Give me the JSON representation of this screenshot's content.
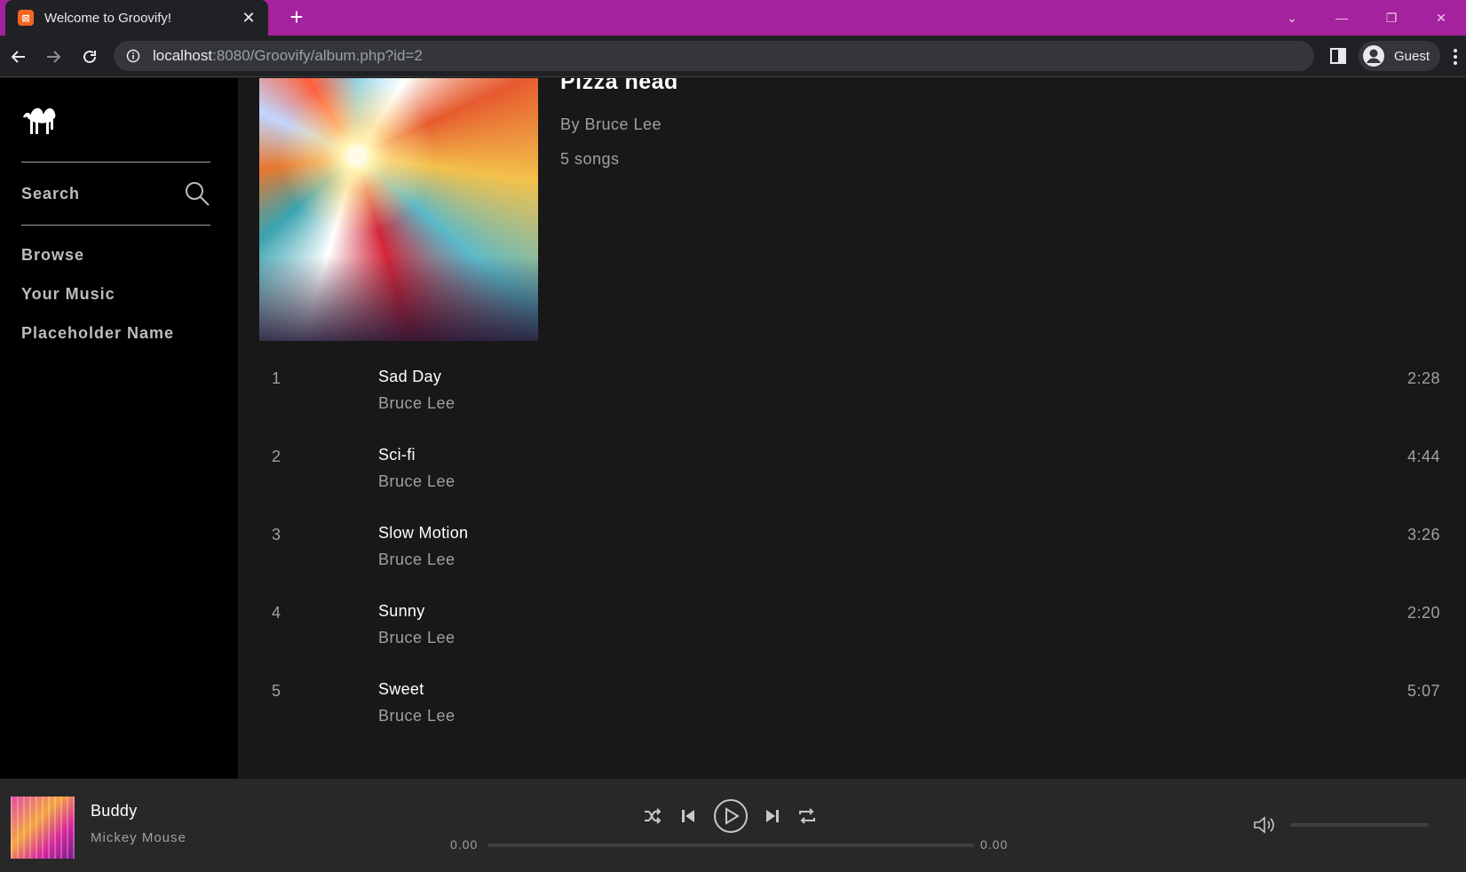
{
  "browser": {
    "tab_title": "Welcome to Groovify!",
    "tab_favicon": "xampp-icon",
    "url_host": "localhost",
    "url_rest": ":8080/Groovify/album.php?id=2",
    "profile_label": "Guest"
  },
  "sidebar": {
    "search_label": "Search",
    "items": [
      {
        "label": "Browse"
      },
      {
        "label": "Your Music"
      },
      {
        "label": "Placeholder Name"
      }
    ]
  },
  "album": {
    "title": "Pizza head",
    "artist": "By Bruce Lee",
    "song_count": "5 songs"
  },
  "tracks": [
    {
      "num": "1",
      "name": "Sad Day",
      "artist": "Bruce Lee",
      "duration": "2:28"
    },
    {
      "num": "2",
      "name": "Sci-fi",
      "artist": "Bruce Lee",
      "duration": "4:44"
    },
    {
      "num": "3",
      "name": "Slow Motion",
      "artist": "Bruce Lee",
      "duration": "3:26"
    },
    {
      "num": "4",
      "name": "Sunny",
      "artist": "Bruce Lee",
      "duration": "2:20"
    },
    {
      "num": "5",
      "name": "Sweet",
      "artist": "Bruce Lee",
      "duration": "5:07"
    }
  ],
  "player": {
    "title": "Buddy",
    "artist": "Mickey Mouse",
    "time_current": "0.00",
    "time_total": "0.00",
    "progress_fraction": 0,
    "volume_fraction": 0
  },
  "colors": {
    "titlebar": "#a5229e",
    "sidebar_bg": "#000000",
    "content_bg": "#181818",
    "player_bg": "#282828",
    "muted_text": "#a0a0a0"
  }
}
